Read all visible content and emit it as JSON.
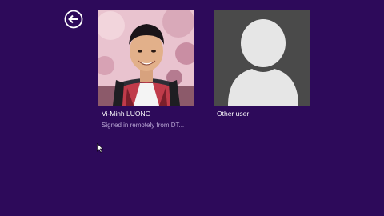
{
  "colors": {
    "background": "#2d0a5a",
    "text_primary": "#ffffff",
    "text_secondary": "#b9a7d4",
    "placeholder_tile": "#4a4a4a",
    "placeholder_silhouette": "#e6e6e6"
  },
  "back_button": {
    "icon": "back-arrow-icon"
  },
  "users": [
    {
      "name": "Vi-Minh LUONG",
      "status": "Signed in remotely from DT...",
      "avatar": "photo"
    },
    {
      "name": "Other user",
      "status": "",
      "avatar": "user-silhouette-icon"
    }
  ]
}
